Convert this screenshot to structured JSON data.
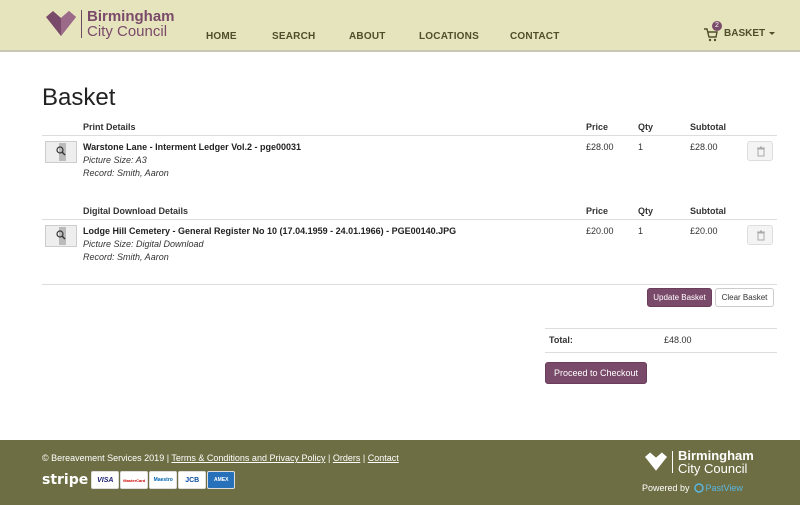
{
  "header": {
    "logo_line1": "Birmingham",
    "logo_line2": "City Council",
    "nav": [
      "HOME",
      "SEARCH",
      "ABOUT",
      "LOCATIONS",
      "CONTACT"
    ],
    "basket_label": "BASKET",
    "basket_count": "2"
  },
  "page_title": "Basket",
  "sections": [
    {
      "heading": "Print Details",
      "col_price": "Price",
      "col_qty": "Qty",
      "col_subtotal": "Subtotal",
      "item": {
        "title": "Warstone Lane - Interment Ledger Vol.2 - pge00031",
        "size": "Picture Size: A3",
        "record": "Record: Smith, Aaron",
        "price": "£28.00",
        "qty": "1",
        "subtotal": "£28.00"
      }
    },
    {
      "heading": "Digital Download Details",
      "col_price": "Price",
      "col_qty": "Qty",
      "col_subtotal": "Subtotal",
      "item": {
        "title": "Lodge Hill Cemetery - General Register No 10 (17.04.1959 - 24.01.1966) - PGE00140.JPG",
        "size": "Picture Size: Digital Download",
        "record": "Record: Smith, Aaron",
        "price": "£20.00",
        "qty": "1",
        "subtotal": "£20.00"
      }
    }
  ],
  "actions": {
    "update_label": "Update Basket",
    "clear_label": "Clear Basket",
    "checkout_label": "Proceed to Checkout"
  },
  "total": {
    "label": "Total:",
    "value": "£48.00"
  },
  "footer": {
    "copyright": "© Bereavement Services 2019",
    "sep": "|",
    "links": [
      "Terms & Conditions and Privacy Policy",
      "Orders",
      "Contact"
    ],
    "stripe": "stripe",
    "cards": [
      "VISA",
      "MasterCard",
      "Maestro",
      "JCB",
      "AMEX"
    ],
    "logo_line1": "Birmingham",
    "logo_line2": "City Council",
    "powered_by": "Powered by",
    "powered_brand": "PastView"
  },
  "colors": {
    "header_bg": "#e6e4bd",
    "brand_purple": "#7a4a6a",
    "footer_bg": "#6e6e44"
  }
}
